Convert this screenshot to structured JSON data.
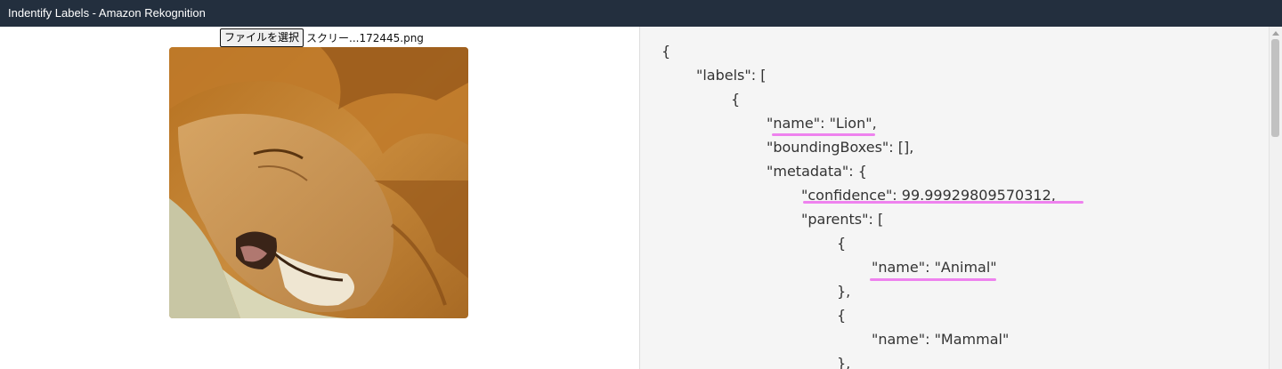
{
  "window": {
    "title": "Indentify Labels - Amazon Rekognition"
  },
  "upload": {
    "button_label": "ファイルを選択",
    "file_name": "スクリー...172445.png"
  },
  "photo": {
    "subject": "sleeping lion"
  },
  "json_output": {
    "lines": [
      "{",
      "\"labels\": [",
      "{",
      "\"name\": \"Lion\",",
      "\"boundingBoxes\": [],",
      "\"metadata\": {",
      "\"confidence\": 99.99929809570312,",
      "\"parents\": [",
      "{",
      "\"name\": \"Animal\"",
      "},",
      "{",
      "\"name\": \"Mammal\"",
      "},"
    ]
  },
  "colors": {
    "titlebar": "#232f3e",
    "highlight": "#ee82ee",
    "json_background": "#f5f5f5"
  }
}
